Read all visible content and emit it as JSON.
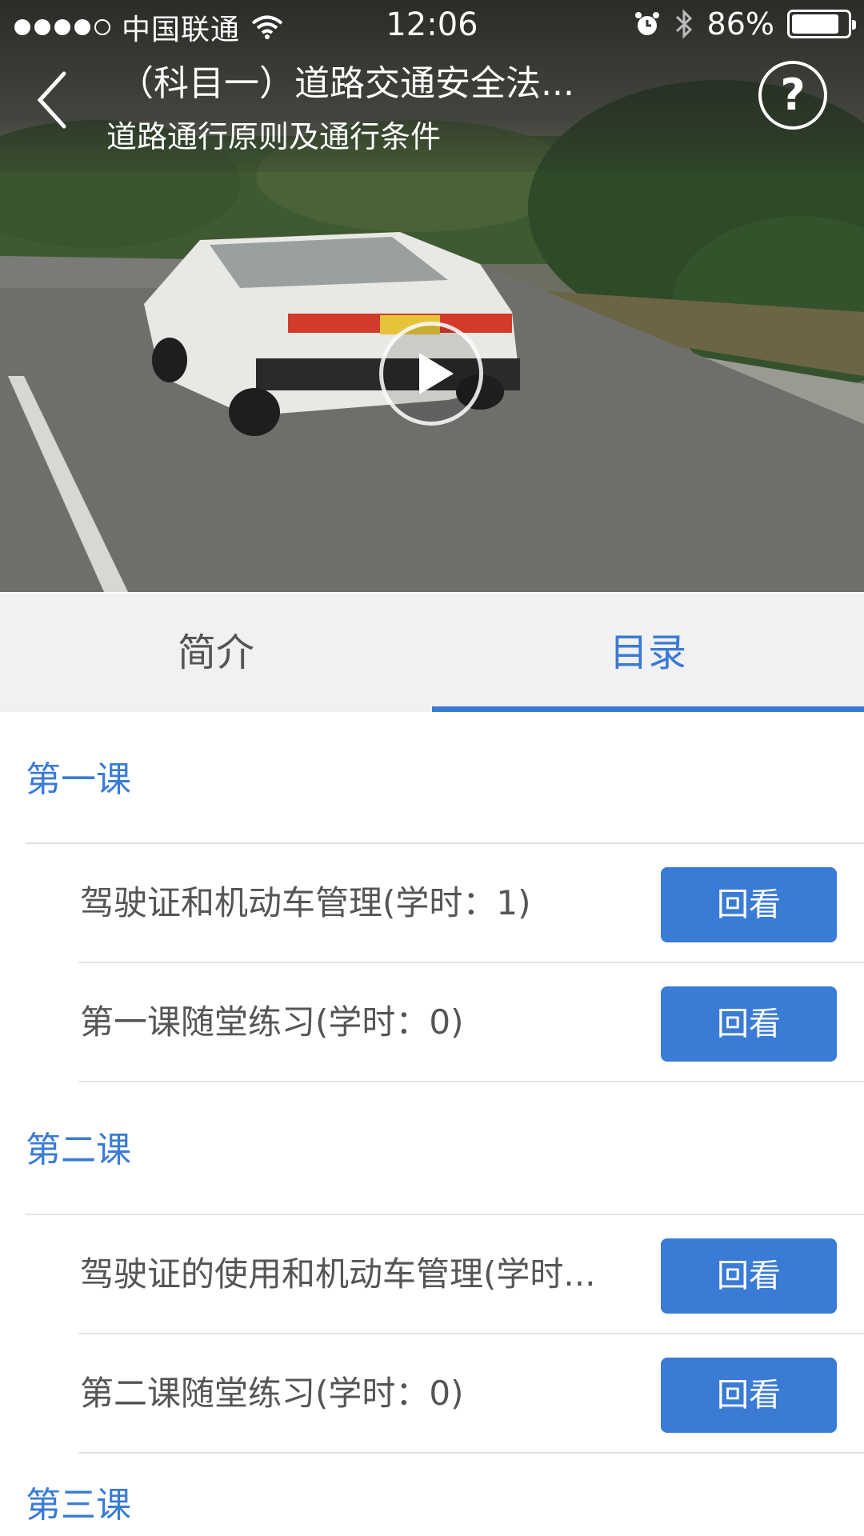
{
  "status_bar": {
    "carrier": "中国联通",
    "time": "12:06",
    "battery_percent": "86%",
    "battery_level": 0.86
  },
  "header": {
    "title": "（科目一）道路交通安全法...",
    "subtitle": "道路通行原则及通行条件",
    "help_label": "?"
  },
  "tabs": [
    {
      "label": "简介",
      "active": false
    },
    {
      "label": "目录",
      "active": true
    }
  ],
  "catalog": {
    "lessons": [
      {
        "title": "第一课",
        "items": [
          {
            "text": "驾驶证和机动车管理(学时：1)",
            "button": "回看"
          },
          {
            "text": "第一课随堂练习(学时：0)",
            "button": "回看"
          }
        ]
      },
      {
        "title": "第二课",
        "items": [
          {
            "text": "驾驶证的使用和机动车管理(学时...",
            "button": "回看"
          },
          {
            "text": "第二课随堂练习(学时：0)",
            "button": "回看"
          }
        ]
      },
      {
        "title": "第三课",
        "items": []
      }
    ]
  },
  "colors": {
    "accent": "#3a7bd5",
    "tab_bg": "#f1f1f1",
    "text": "#555555",
    "divider": "#e2e2e2"
  }
}
